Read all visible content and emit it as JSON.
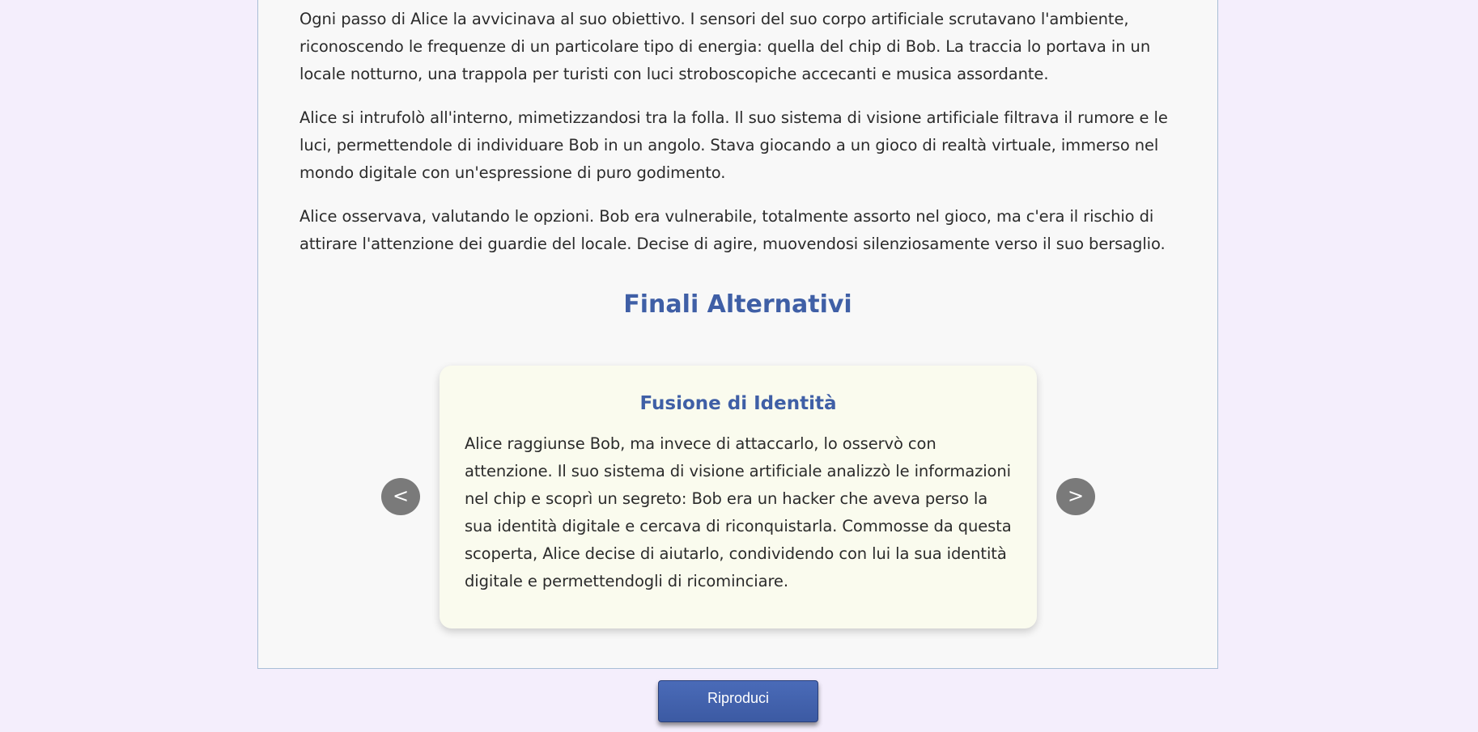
{
  "story": {
    "paragraphs": [
      "Ogni passo di Alice la avvicinava al suo obiettivo. I sensori del suo corpo artificiale scrutavano l'ambiente, riconoscendo le frequenze di un particolare tipo di energia: quella del chip di Bob. La traccia lo portava in un locale notturno, una trappola per turisti con luci stroboscopiche accecanti e musica assordante.",
      "Alice si intrufolò all'interno, mimetizzandosi tra la folla. Il suo sistema di visione artificiale filtrava il rumore e le luci, permettendole di individuare Bob in un angolo. Stava giocando a un gioco di realtà virtuale, immerso nel mondo digitale con un'espressione di puro godimento.",
      "Alice osservava, valutando le opzioni. Bob era vulnerabile, totalmente assorto nel gioco, ma c'era il rischio di attirare l'attenzione dei guardie del locale. Decise di agire, muovendosi silenziosamente verso il suo bersaglio."
    ]
  },
  "endings": {
    "section_title": "Finali Alternativi",
    "current": {
      "title": "Fusione di Identità",
      "text": "Alice raggiunse Bob, ma invece di attaccarlo, lo osservò con attenzione. Il suo sistema di visione artificiale analizzò le informazioni nel chip e scoprì un segreto: Bob era un hacker che aveva perso la sua identità digitale e cercava di riconquistarla. Commosse da questa scoperta, Alice decise di aiutarlo, condividendo con lui la sua identità digitale e permettendogli di ricominciare."
    },
    "prev_label": "<",
    "next_label": ">"
  },
  "play_button_label": "Riproduci",
  "colors": {
    "background": "#f4eefc",
    "card": "#f8f8f8",
    "accent": "#3f5fa6",
    "ending_card": "#fafbee",
    "nav_button": "#7a7a7a",
    "play_button": "#4563ae"
  }
}
